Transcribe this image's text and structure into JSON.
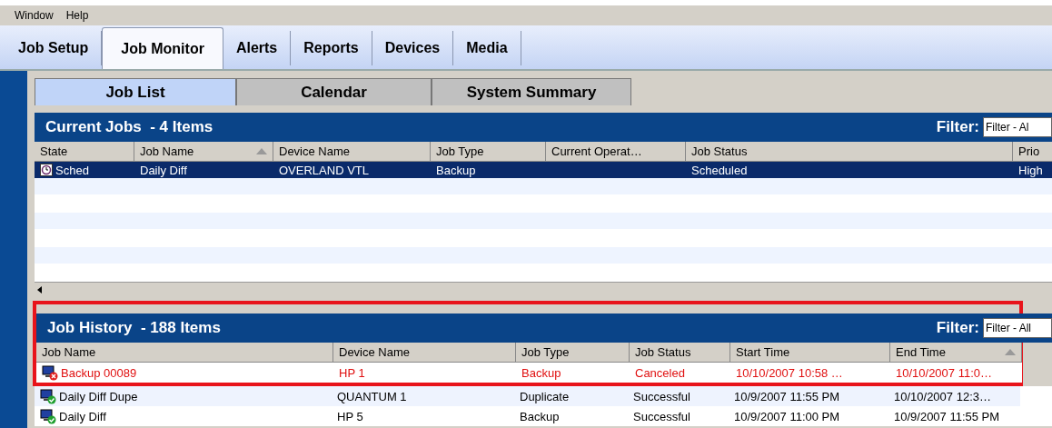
{
  "menu_bar": [
    "Window",
    "Help"
  ],
  "main_tabs": [
    {
      "label": "Job Setup",
      "selected": false
    },
    {
      "label": "Job Monitor",
      "selected": true
    },
    {
      "label": "Alerts",
      "selected": false
    },
    {
      "label": "Reports",
      "selected": false
    },
    {
      "label": "Devices",
      "selected": false
    },
    {
      "label": "Media",
      "selected": false
    }
  ],
  "sub_tabs": [
    {
      "label": "Job List",
      "selected": true
    },
    {
      "label": "Calendar",
      "selected": false
    },
    {
      "label": "System Summary",
      "selected": false
    }
  ],
  "current_jobs": {
    "title": "Current Jobs  - 4 Items",
    "filter_label": "Filter:",
    "filter_value": "Filter - Al",
    "columns": [
      {
        "label": "State",
        "sorted": false
      },
      {
        "label": "Job Name",
        "sorted": true
      },
      {
        "label": "Device Name",
        "sorted": false
      },
      {
        "label": "Job Type",
        "sorted": false
      },
      {
        "label": "Current Operat…",
        "sorted": false
      },
      {
        "label": "Job Status",
        "sorted": false
      },
      {
        "label": "Prio",
        "sorted": false
      }
    ],
    "rows": [
      {
        "selected": true,
        "cells": [
          "Sched",
          "Daily Diff",
          "OVERLAND VTL",
          "Backup",
          "",
          "Scheduled",
          "High"
        ]
      }
    ]
  },
  "job_history": {
    "title": "Job History  - 188 Items",
    "filter_label": "Filter:",
    "filter_value": "Filter - All",
    "highlighted": true,
    "columns": [
      {
        "label": "Job Name",
        "sorted": false
      },
      {
        "label": "Device Name",
        "sorted": false
      },
      {
        "label": "Job Type",
        "sorted": false
      },
      {
        "label": "Job Status",
        "sorted": false
      },
      {
        "label": "Start Time",
        "sorted": false
      },
      {
        "label": "End Time",
        "sorted": true
      }
    ],
    "rows": [
      {
        "kind": "failed",
        "cells": [
          "Backup 00089",
          "HP 1",
          "Backup",
          "Canceled",
          "10/10/2007 10:58 …",
          "10/10/2007 11:0…"
        ]
      },
      {
        "kind": "success",
        "cells": [
          "Daily Diff Dupe",
          "QUANTUM 1",
          "Duplicate",
          "Successful",
          "10/9/2007 11:55 PM",
          "10/10/2007 12:3…"
        ]
      },
      {
        "kind": "success",
        "cells": [
          "Daily Diff",
          "HP 5",
          "Backup",
          "Successful",
          "10/9/2007 11:00 PM",
          "10/9/2007 11:55 PM"
        ]
      }
    ]
  }
}
